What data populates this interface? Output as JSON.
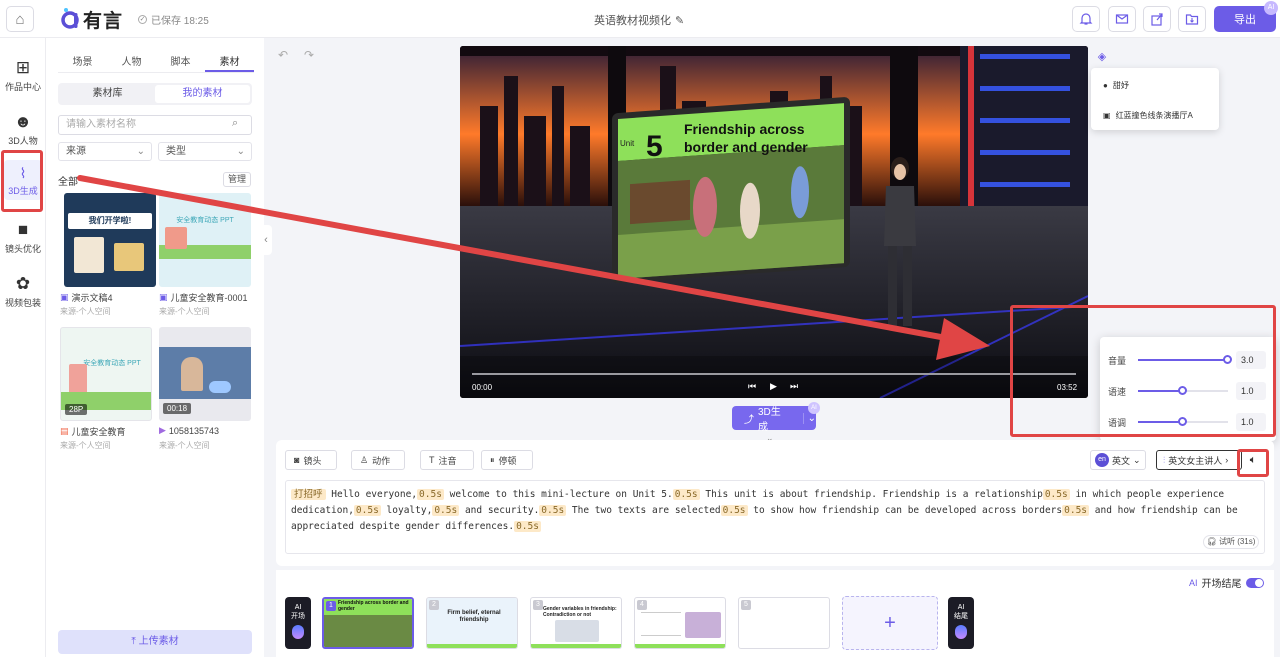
{
  "header": {
    "logo_text": "有言",
    "saved_status": "已保存 18:25",
    "doc_title": "英语教材视频化",
    "export_label": "导出",
    "ai_badge": "AI"
  },
  "nav": [
    {
      "label": "作品中心"
    },
    {
      "label": "3D人物"
    },
    {
      "label": "3D生成"
    },
    {
      "label": "镜头优化"
    },
    {
      "label": "视频包装"
    }
  ],
  "panel": {
    "tabs": [
      "场景",
      "人物",
      "脚本",
      "素材"
    ],
    "segments": [
      "素材库",
      "我的素材"
    ],
    "search_placeholder": "请输入素材名称",
    "filter_source": "来源",
    "filter_type": "类型",
    "all_label": "全部",
    "manage_label": "管理",
    "items": [
      {
        "name": "演示文稿4",
        "source": "来源-个人空间",
        "thumb_text": "我们开学啦!"
      },
      {
        "name": "儿童安全教育-0001",
        "source": "来源-个人空间",
        "thumb_text": "安全教育动态 PPT"
      },
      {
        "name": "儿童安全教育",
        "source": "来源-个人空间",
        "badge": "28P",
        "thumb_text": "安全教育动态 PPT"
      },
      {
        "name": "1058135743",
        "source": "来源-个人空间",
        "badge": "00:18"
      }
    ],
    "upload_label": "上传素材"
  },
  "video": {
    "unit_word": "Unit",
    "unit_number": "5",
    "card_title_line1": "Friendship across",
    "card_title_line2": "border and gender",
    "time_current": "00:00",
    "time_total": "03:52",
    "progress": 0
  },
  "layers": [
    "甜妤",
    "红蓝撞色线条演播厅A"
  ],
  "generate": {
    "label": "3D生成",
    "ai": "AI"
  },
  "audio": {
    "rows": [
      {
        "label": "音量",
        "value": "3.0",
        "fraction": 1.0
      },
      {
        "label": "语速",
        "value": "1.0",
        "fraction": 0.5
      },
      {
        "label": "语调",
        "value": "1.0",
        "fraction": 0.5
      }
    ]
  },
  "script": {
    "tools": [
      "镜头",
      "动作",
      "注音",
      "停顿"
    ],
    "lang_badge": "en",
    "lang_label": "英文",
    "voice_label": "英文女主讲人",
    "greeting_tag": "打招呼",
    "pause_tag": "0.5s",
    "segments": [
      "Hello everyone,",
      "welcome to this mini-lecture on Unit 5.",
      "This unit is about friendship. Friendship is a relationship",
      "in which people experience dedication,",
      "loyalty,",
      "and security.",
      "The two texts are selected",
      "to show how friendship can be developed across borders",
      "and how friendship can be appreciated despite gender differences."
    ],
    "listen_label": "试听 (31s)"
  },
  "timeline": {
    "opening_label": "开场结尾",
    "ai_open": [
      "AI",
      "开场"
    ],
    "ai_end": [
      "AI",
      "结尾"
    ],
    "scenes": [
      {
        "num": "1",
        "title": "Friendship across border and gender"
      },
      {
        "num": "2",
        "title": "Firm belief, eternal friendship"
      },
      {
        "num": "3",
        "title": "Gender variables in friendship: Contradiction or not"
      },
      {
        "num": "4",
        "title": ""
      },
      {
        "num": "5",
        "title": ""
      }
    ],
    "add_label": "+"
  }
}
